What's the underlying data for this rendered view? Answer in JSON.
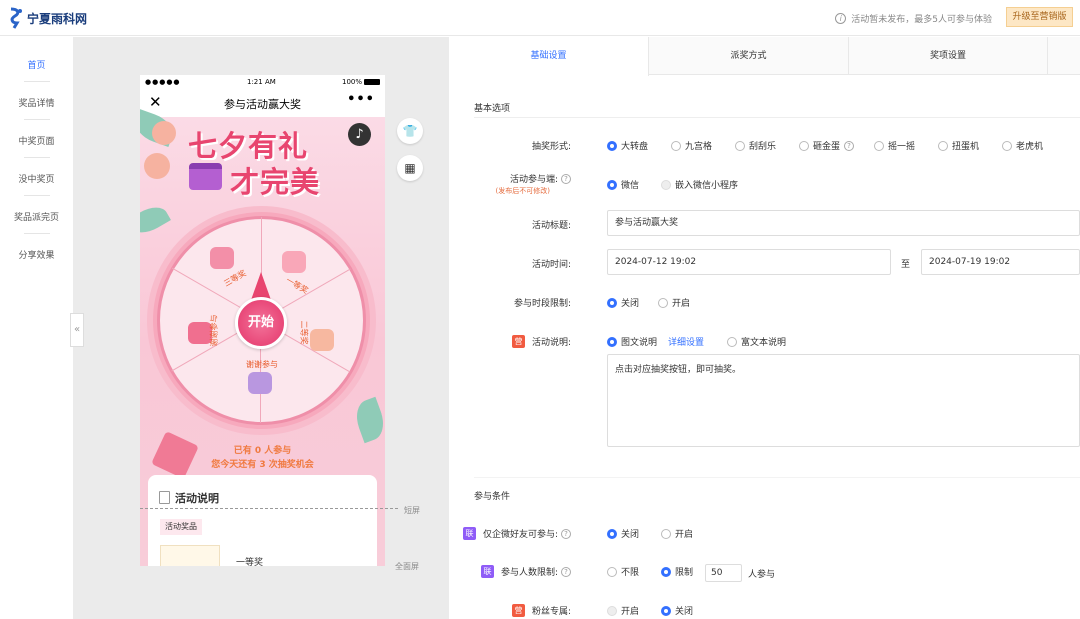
{
  "header": {
    "logo_text": "宁夏雨科网",
    "notice": "活动暂未发布，最多5人可参与体验",
    "upgrade_label": "升级至营销版"
  },
  "sidenav": {
    "items": [
      {
        "label": "首页",
        "active": true
      },
      {
        "label": "奖品详情"
      },
      {
        "label": "中奖页面"
      },
      {
        "label": "没中奖页"
      },
      {
        "label": "奖品派完页"
      },
      {
        "label": "分享效果"
      }
    ],
    "collapse_glyph": "«"
  },
  "phone": {
    "status": {
      "carrier": "●●●●●",
      "time": "1:21 AM",
      "battery": "100%"
    },
    "nav_title": "参与活动赢大奖",
    "close_glyph": "✕",
    "more_glyph": "•••",
    "poster": {
      "title_line1": "七夕有礼",
      "title_line2": "才完美",
      "start_label": "开始",
      "count_line1": "已有 0 人参与",
      "count_line2": "您今天还有 3 次抽奖机会",
      "prizes": [
        "三等奖",
        "一等奖",
        "二等奖",
        "谢谢参与",
        "谢谢参与",
        "谢谢参与"
      ]
    },
    "card": {
      "title": "活动说明",
      "tag": "活动奖品",
      "first_prize": "一等奖"
    }
  },
  "preview_labels": {
    "short_screen": "短屏",
    "full_screen": "全面屏"
  },
  "tools": {
    "shirt_icon": "shirt-icon",
    "grid_icon": "grid-icon"
  },
  "tabs": [
    "基础设置",
    "派奖方式",
    "奖项设置"
  ],
  "basic": {
    "section_title": "基本选项",
    "draw_type": {
      "label": "抽奖形式:",
      "options": [
        "大转盘",
        "九宫格",
        "刮刮乐",
        "砸金蛋",
        "摇一摇",
        "扭蛋机",
        "老虎机"
      ],
      "selected": "大转盘"
    },
    "entry": {
      "label": "活动参与端:",
      "note": "(发布后不可修改)",
      "options": [
        "微信",
        "嵌入微信小程序"
      ],
      "selected": "微信"
    },
    "title": {
      "label": "活动标题:",
      "value": "参与活动赢大奖"
    },
    "time": {
      "label": "活动时间:",
      "start": "2024-07-12 19:02",
      "to": "至",
      "end": "2024-07-19 19:02"
    },
    "period_limit": {
      "label": "参与时段限制:",
      "options": [
        "关闭",
        "开启"
      ],
      "selected": "关闭"
    },
    "description": {
      "badge": "营",
      "label": "活动说明:",
      "options": [
        "图文说明",
        "富文本说明"
      ],
      "selected": "图文说明",
      "detail_link": "详细设置",
      "content": "点击对应抽奖按钮，即可抽奖。"
    }
  },
  "conditions": {
    "section_title": "参与条件",
    "wecom_friend": {
      "badge": "联",
      "label": "仅企微好友可参与:",
      "options": [
        "关闭",
        "开启"
      ],
      "selected": "关闭"
    },
    "people_limit": {
      "badge": "联",
      "label": "参与人数限制:",
      "options": [
        "不限",
        "限制"
      ],
      "selected": "限制",
      "value": "50",
      "suffix": "人参与"
    },
    "fans_only": {
      "badge": "营",
      "label": "粉丝专属:",
      "options": [
        "开启",
        "关闭"
      ],
      "selected": "关闭"
    }
  },
  "colors": {
    "accent": "#3370ff",
    "brand_pink": "#e8456f",
    "badge_red": "#f15b40",
    "badge_purple": "#8f5cf7"
  }
}
